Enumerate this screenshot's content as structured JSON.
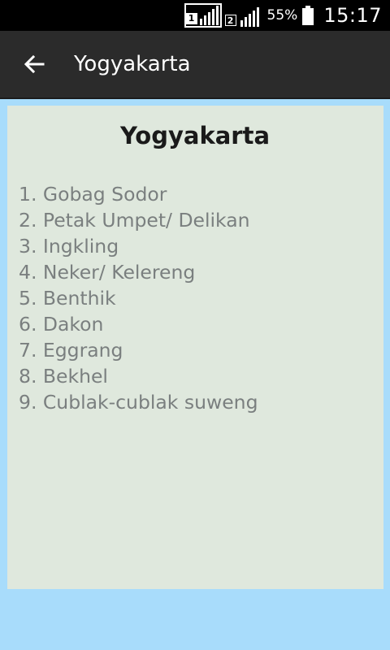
{
  "status_bar": {
    "sim1_label": "1",
    "sim2_label": "2",
    "battery_percent": "55%",
    "time": "15:17"
  },
  "app_bar": {
    "back_icon": "arrow-left-icon",
    "title": "Yogyakarta"
  },
  "content": {
    "heading": "Yogyakarta",
    "items": [
      "1. Gobag Sodor",
      "2. Petak Umpet/ Delikan",
      "3. Ingkling",
      "4. Neker/ Kelereng",
      "5. Benthik",
      "6. Dakon",
      "7. Eggrang",
      "8. Bekhel",
      "9. Cublak-cublak suweng"
    ]
  },
  "colors": {
    "status_bar_bg": "#000000",
    "app_bar_bg": "#2b2b2b",
    "page_bg": "#a8dcfb",
    "card_bg": "#dfe8dd",
    "list_text": "#7a7f7f"
  }
}
